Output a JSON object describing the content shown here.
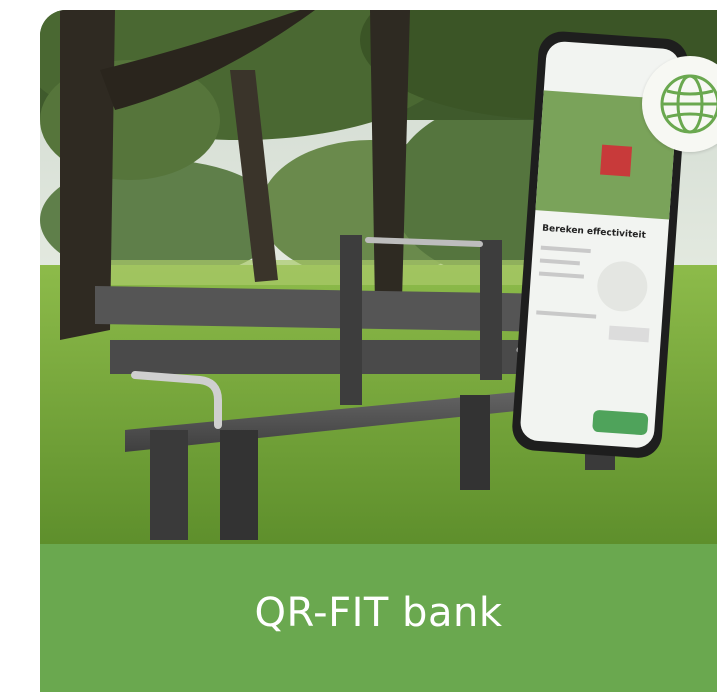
{
  "card": {
    "title": "QR-FIT bank",
    "badge_icon": "globe-icon",
    "colors": {
      "band": "#6aa84f",
      "text": "#ffffff",
      "badge_bg": "#f7f8f3",
      "badge_icon": "#6aa84f"
    }
  },
  "phone_screen": {
    "heading": "Bereken effectiviteit"
  }
}
